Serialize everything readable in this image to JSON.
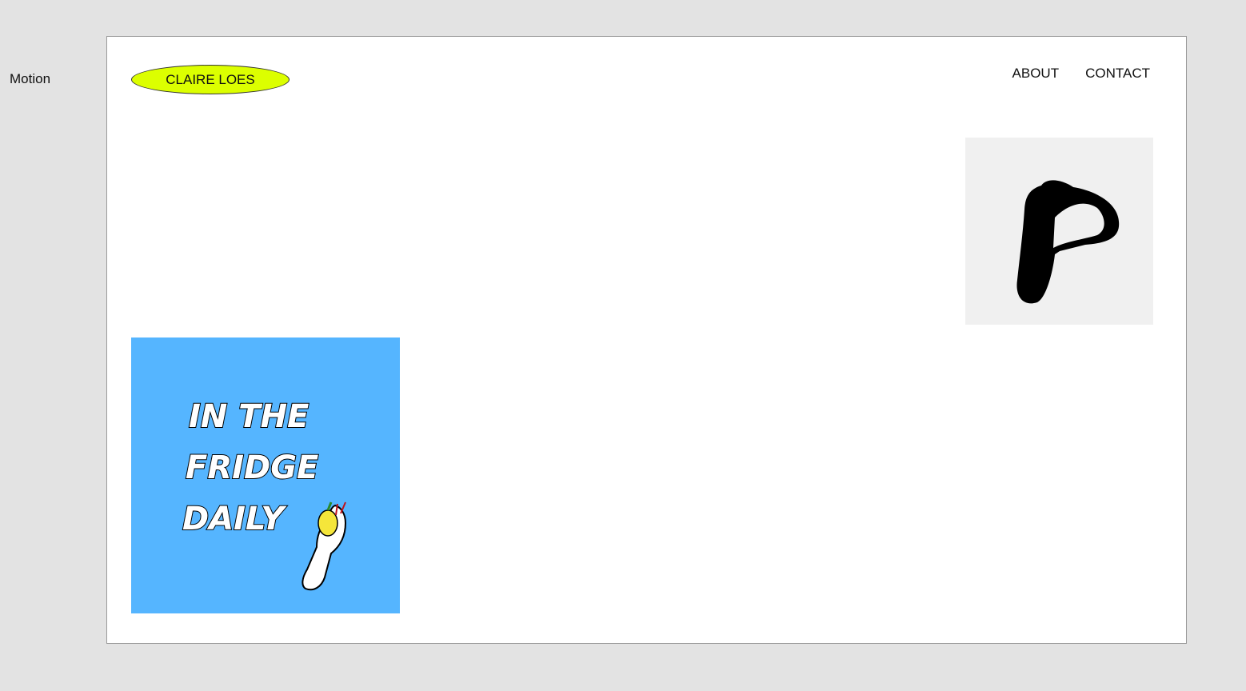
{
  "sidebar": {
    "label": "Motion"
  },
  "header": {
    "logo_text": "CLAIRE LOES",
    "nav": [
      {
        "label": "ABOUT"
      },
      {
        "label": "CONTACT"
      }
    ]
  },
  "colors": {
    "page_bg": "#e3e3e3",
    "frame_bg": "#ffffff",
    "logo_fill": "#dcff00",
    "fridge_bg": "#55b5ff",
    "p_tile_bg": "#f0f0f0"
  },
  "tiles": [
    {
      "name": "hand-drawn-p-thumbnail",
      "lettering": "P"
    },
    {
      "name": "in-the-fridge-daily-thumbnail",
      "lettering": [
        "IN THE",
        "FRIDGE",
        "DAILY"
      ]
    }
  ]
}
